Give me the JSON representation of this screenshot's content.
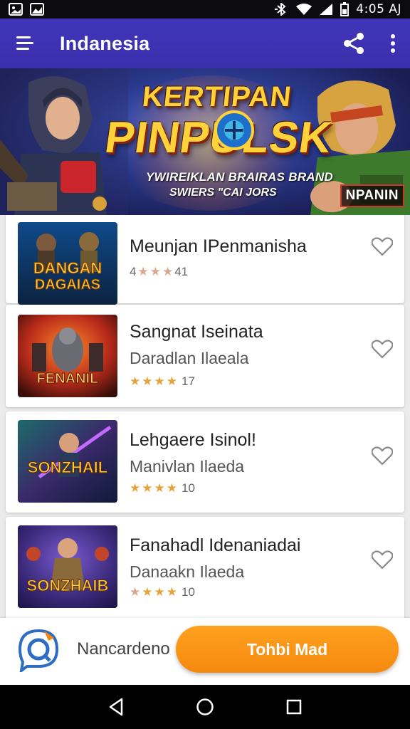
{
  "status_bar": {
    "time": "4:05 AJ",
    "icons": [
      "image-icon",
      "gallery-icon",
      "bluetooth-icon",
      "wifi-icon",
      "signal-icon",
      "battery-icon"
    ]
  },
  "app_bar": {
    "title": "Indanesia",
    "icons": [
      "menu-icon",
      "share-icon",
      "more-vert-icon"
    ]
  },
  "banner": {
    "title_line1": "KERTIPAN",
    "title_line2": "PINPULSK",
    "subtitle_line1": "YWIREIKLAN BRAIRAS BRAND",
    "subtitle_line2": "SWIERS \"CAI JORS",
    "badge": "NPANIN"
  },
  "list": {
    "items": [
      {
        "title": "Meunjan IPenmanisha",
        "subtitle": "",
        "rating_text": "4 ★★★ 41",
        "rating_prefix": "4",
        "rating_count": "41",
        "stars": 3,
        "thumb_text": "DANGAN DAGAIAS",
        "favorite": false
      },
      {
        "title": "Sangnat Iseinata",
        "subtitle": "Daradlan Ilaeala",
        "rating_prefix": "",
        "rating_count": "17",
        "stars": 4,
        "thumb_text": "FENANIL",
        "favorite": false
      },
      {
        "title": "Lehgaere Isinol!",
        "subtitle": "Manivlan Ilaeda",
        "rating_prefix": "",
        "rating_count": "10",
        "stars": 4,
        "thumb_text": "SONZHAIL",
        "favorite": false
      },
      {
        "title": "Fanahadl Idenaniadai",
        "subtitle": "Danaakn Ilaeda",
        "rating_prefix": "",
        "rating_count": "10",
        "stars": 4,
        "thumb_text": "SONZHAIB",
        "favorite": false
      }
    ]
  },
  "bottom_bar": {
    "label": "Nancardeno",
    "button_label": "Tohbi Mad",
    "accent": "#f5890f"
  },
  "nav_bar": {
    "icons": [
      "back-icon",
      "home-icon",
      "recents-icon"
    ]
  },
  "colors": {
    "app_bar": "#3a30ad",
    "star": "#e8a33a",
    "button": "#f5890f"
  }
}
